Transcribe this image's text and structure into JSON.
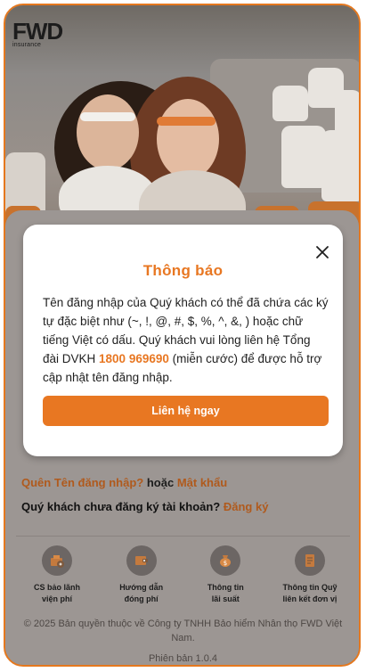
{
  "brand": {
    "logo_text": "FWD",
    "logo_sub": "insurance"
  },
  "links": {
    "forgot_username": "Quên Tên đăng nhập?",
    "or": "hoặc",
    "password": "Mật khẩu",
    "no_account": "Quý khách chưa đăng ký tài khoản?",
    "register": "Đăng ký"
  },
  "quick_links": [
    {
      "label_line1": "CS bảo lãnh",
      "label_line2": "viện phí",
      "icon": "hospital-guarantee-icon"
    },
    {
      "label_line1": "Hướng dẫn",
      "label_line2": "đóng phí",
      "icon": "payment-guide-icon"
    },
    {
      "label_line1": "Thông tin",
      "label_line2": "lãi suất",
      "icon": "interest-rate-icon"
    },
    {
      "label_line1": "Thông tin Quỹ",
      "label_line2": "liên kết đơn vị",
      "icon": "unit-linked-fund-icon"
    }
  ],
  "footer": {
    "copyright": "© 2025 Bản quyền thuộc về Công ty TNHH Bảo hiểm Nhân thọ FWD Việt Nam.",
    "version": "Phiên bản 1.0.4"
  },
  "dialog": {
    "title": "Thông báo",
    "body_part1": "Tên đăng nhập của Quý khách có thể đã chứa các ký tự đặc biệt như (~, !, @, #, $, %, ^, &, ) hoặc chữ tiếng Việt có dấu. Quý khách vui lòng liên hệ Tổng đài DVKH ",
    "phone": "1800 969690",
    "body_part2": " (miễn cước) để được hỗ trợ cập nhật tên đăng nhập.",
    "button_label": "Liên hệ ngay",
    "close_icon": "close-icon"
  },
  "colors": {
    "accent": "#e87722",
    "frame": "#e5781e",
    "overlay": "#9c9693"
  }
}
